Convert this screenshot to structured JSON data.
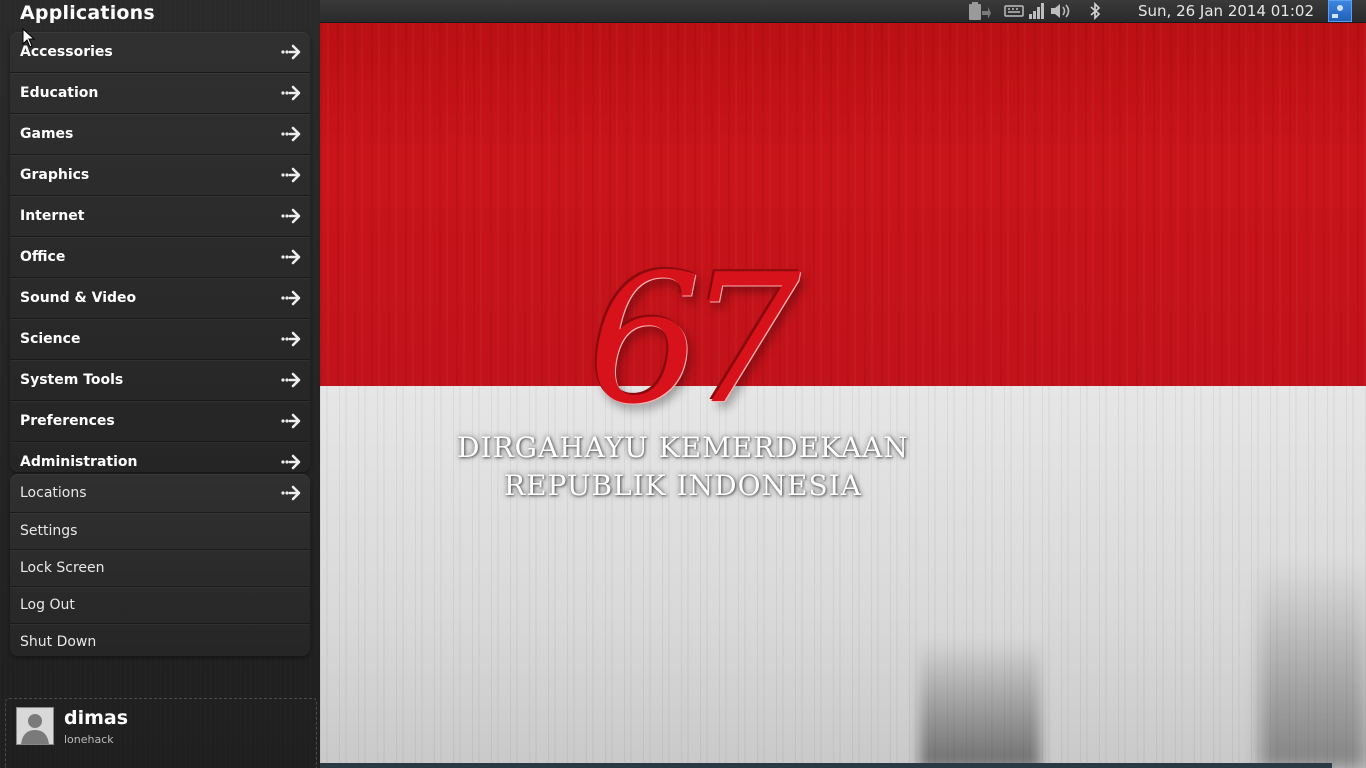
{
  "sidebar": {
    "title": "Applications",
    "app_categories": [
      {
        "label": "Accessories"
      },
      {
        "label": "Education"
      },
      {
        "label": "Games"
      },
      {
        "label": "Graphics"
      },
      {
        "label": "Internet"
      },
      {
        "label": "Office"
      },
      {
        "label": "Sound & Video"
      },
      {
        "label": "Science"
      },
      {
        "label": "System Tools"
      },
      {
        "label": "Preferences"
      },
      {
        "label": "Administration"
      }
    ],
    "system_items": [
      {
        "label": "Locations",
        "has_arrow": true
      },
      {
        "label": "Settings"
      },
      {
        "label": "Lock Screen"
      },
      {
        "label": "Log Out"
      },
      {
        "label": "Shut Down"
      }
    ],
    "user": {
      "name": "dimas",
      "host": "lonehack"
    }
  },
  "top_panel": {
    "clock": "Sun, 26 Jan 2014 01:02",
    "tray_icons": [
      "battery-icon",
      "keyboard-icon",
      "network-signal-icon",
      "volume-icon",
      "bluetooth-icon",
      "user-menu-icon"
    ]
  },
  "wallpaper": {
    "number": "67",
    "line1": "DIRGAHAYU KEMERDEKAAN",
    "line2": "REPUBLIK INDONESIA",
    "colors": {
      "red": "#c9141a",
      "white": "#e0e0e0"
    }
  }
}
